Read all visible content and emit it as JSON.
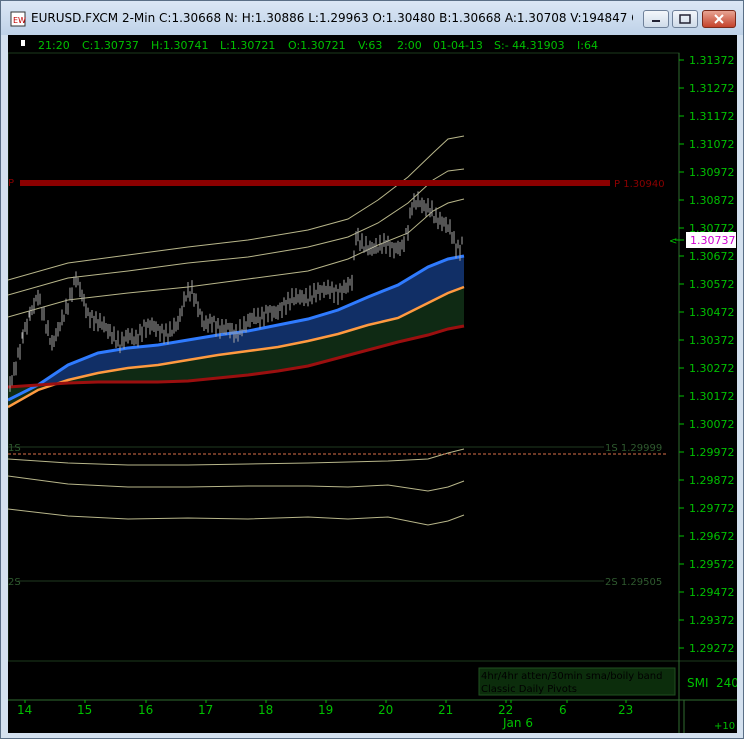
{
  "window": {
    "title": "EURUSD.FXCM 2-Min C:1.30668 N: H:1.30886 L:1.29963 O:1.30480 B:1.30668 A:1.30708 V:194847 OI:0 FXCM EUR US..."
  },
  "info_bar": {
    "time": "21:20",
    "close": "C:1.30737",
    "high": "H:1.30741",
    "low": "L:1.30721",
    "open": "O:1.30721",
    "volume": "V:63",
    "interval": "2:00",
    "date": "01-04-13",
    "s_value": "S:- 44.31903",
    "i_value": "I:64"
  },
  "price_axis": {
    "labels": [
      "1.31372",
      "1.31272",
      "1.31172",
      "1.31072",
      "1.30972",
      "1.30872",
      "1.30772",
      "1.30672",
      "1.30572",
      "1.30472",
      "1.30372",
      "1.30272",
      "1.30172",
      "1.30072",
      "1.29972",
      "1.29872",
      "1.29772",
      "1.29672",
      "1.29572",
      "1.29472",
      "1.29372",
      "1.29272"
    ],
    "current_price": "1.30737"
  },
  "pivots": {
    "p_label": "P",
    "p_value": "P 1.30940",
    "s1_label": "1S",
    "s1_value": "1S 1.29999",
    "s2_label": "2S",
    "s2_value": "2S 1.29505"
  },
  "indicator_panel": {
    "legend_line1": "4hr/4hr atten/30min sma/boily band",
    "legend_line2": "Classic Daily Pivots",
    "smi_label": "SMI",
    "smi_value": "240"
  },
  "time_axis": {
    "labels": [
      "14",
      "15",
      "16",
      "17",
      "18",
      "19",
      "20",
      "21",
      "22",
      "Jan 6",
      "6",
      "23"
    ],
    "zoom_label": "+10"
  },
  "colors": {
    "background": "#000000",
    "price_bars": "#a6a6a6",
    "pivot_p": "#8b0000",
    "pivot_s1": "#d9704a",
    "axis_text": "#00c000",
    "blue_band": "#2f7bff",
    "orange_band": "#ff9a40",
    "red_band": "#9b0f0f",
    "bollinger": "#b8b68a"
  }
}
